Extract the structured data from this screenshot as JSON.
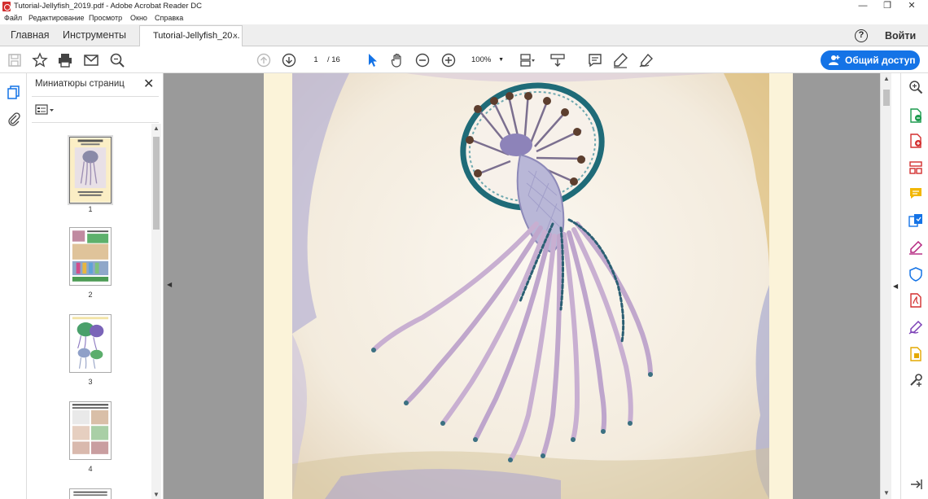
{
  "window": {
    "title": "Tutorial-Jellyfish_2019.pdf - Adobe Acrobat Reader DC",
    "minimize": "—",
    "restore": "❐",
    "close": "✕"
  },
  "menu": {
    "file": "Файл",
    "edit": "Редактирование",
    "view": "Просмотр",
    "window": "Окно",
    "help": "Справка"
  },
  "tabs": {
    "home": "Главная",
    "tools": "Инструменты",
    "document": "Tutorial-Jellyfish_20...",
    "document_close": "×",
    "help": "?",
    "sign_in": "Войти"
  },
  "toolbar": {
    "current_page": "1",
    "page_total": "/ 16",
    "zoom": "100%",
    "share_label": "Общий доступ",
    "accent": "#1473e6"
  },
  "panel": {
    "title": "Миниатюры страниц",
    "close": "✕",
    "thumbnails": [
      {
        "label": "1",
        "selected": true
      },
      {
        "label": "2",
        "selected": false
      },
      {
        "label": "3",
        "selected": false
      },
      {
        "label": "4",
        "selected": false
      }
    ]
  },
  "icons": {
    "left_rail": [
      "pages-icon",
      "attachment-icon"
    ],
    "right_rail": [
      "search-icon",
      "export-pdf-icon",
      "create-pdf-icon",
      "organize-pages-icon",
      "comment-icon",
      "combine-files-icon",
      "fill-sign-icon",
      "protect-icon",
      "edit-pdf-icon",
      "send-for-signature-icon",
      "compress-icon",
      "more-tools-icon"
    ]
  }
}
